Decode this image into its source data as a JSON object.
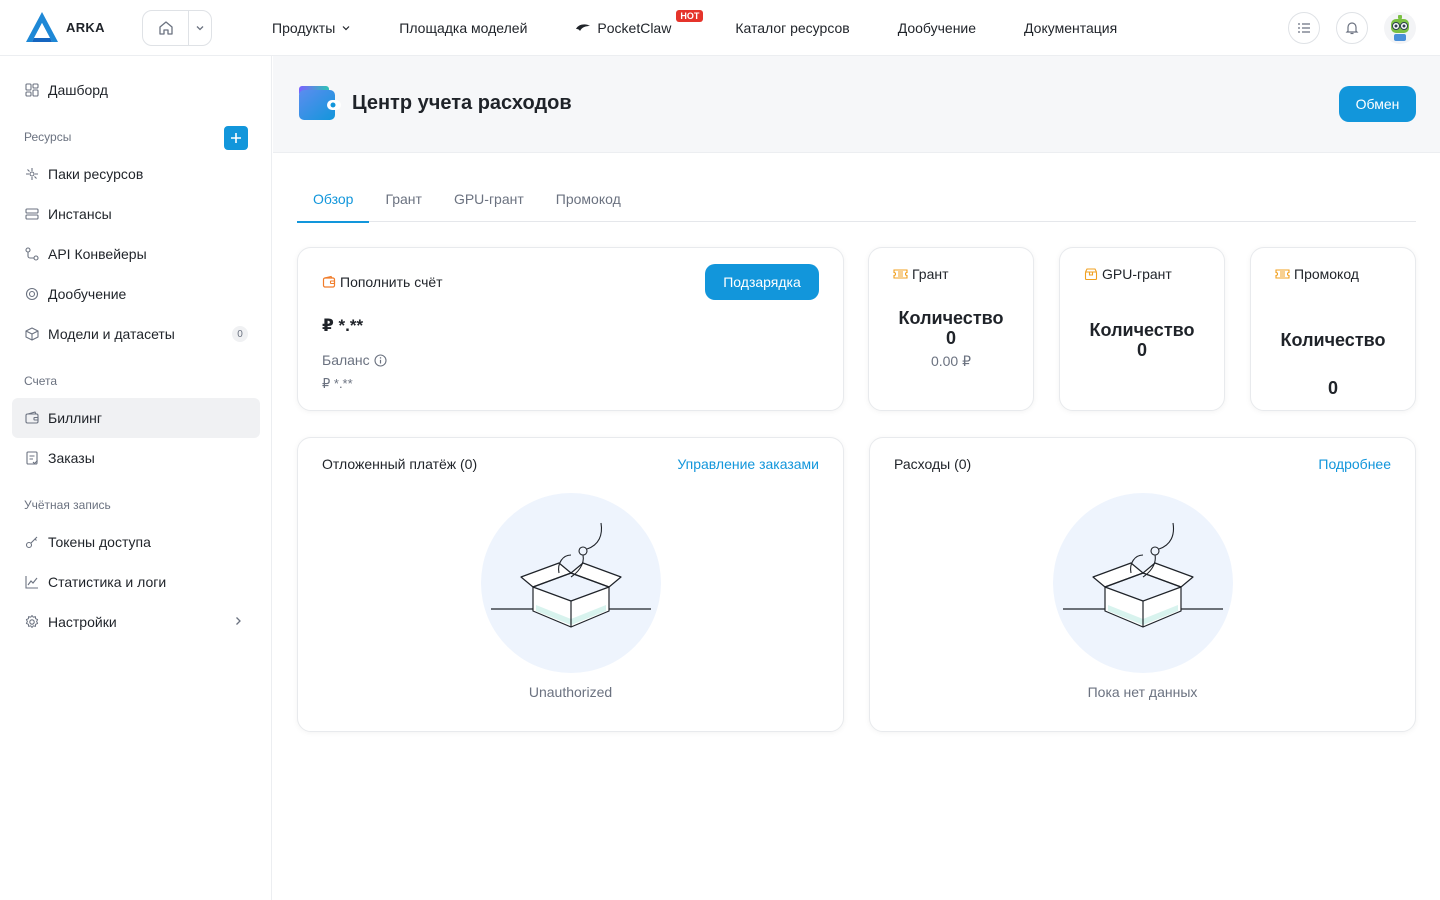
{
  "brand": {
    "name": "ARKA"
  },
  "nav": {
    "products": "Продукты",
    "model_hub": "Площадка моделей",
    "pocketclaw": "PocketClaw",
    "hot_badge": "HOT",
    "catalog": "Каталог ресурсов",
    "finetune": "Дообучение",
    "docs": "Документация"
  },
  "sidebar": {
    "dashboard": "Дашборд",
    "section_resources": "Ресурсы",
    "resource_packs": "Паки ресурсов",
    "instances": "Инстансы",
    "api_pipelines": "API Конвейеры",
    "finetune": "Дообучение",
    "models_datasets": "Модели и датасеты",
    "models_count": "0",
    "section_accounts": "Счета",
    "billing": "Биллинг",
    "orders": "Заказы",
    "section_account": "Учётная запись",
    "access_tokens": "Токены доступа",
    "stats_logs": "Статистика и логи",
    "settings": "Настройки"
  },
  "page": {
    "title": "Центр учета расходов",
    "exchange_button": "Обмен"
  },
  "tabs": [
    "Обзор",
    "Грант",
    "GPU-грант",
    "Промокод"
  ],
  "recharge": {
    "title": "Пополнить счёт",
    "button": "Подзарядка",
    "balance_main": "₽ *.**",
    "balance_label": "Баланс",
    "balance_sub": "₽ *.**"
  },
  "grant": {
    "title": "Грант",
    "label": "Количество",
    "value": "0",
    "amount": "0.00 ₽"
  },
  "gpu_grant": {
    "title": "GPU-грант",
    "label": "Количество",
    "value": "0"
  },
  "promo": {
    "title": "Промокод",
    "label": "Количество",
    "value": "0"
  },
  "pending": {
    "title": "Отложенный платёж (0)",
    "link": "Управление заказами",
    "empty": "Unauthorized"
  },
  "expenses": {
    "title": "Расходы (0)",
    "link": "Подробнее",
    "empty": "Пока нет данных"
  },
  "colors": {
    "accent": "#1296db",
    "hot": "#e5342b",
    "voucher_icon": "#f0a020"
  },
  "icons": {
    "logo": "arka-logo-icon",
    "home": "home-icon",
    "list": "list-icon",
    "bell": "bell-icon",
    "wallet": "wallet-icon"
  }
}
